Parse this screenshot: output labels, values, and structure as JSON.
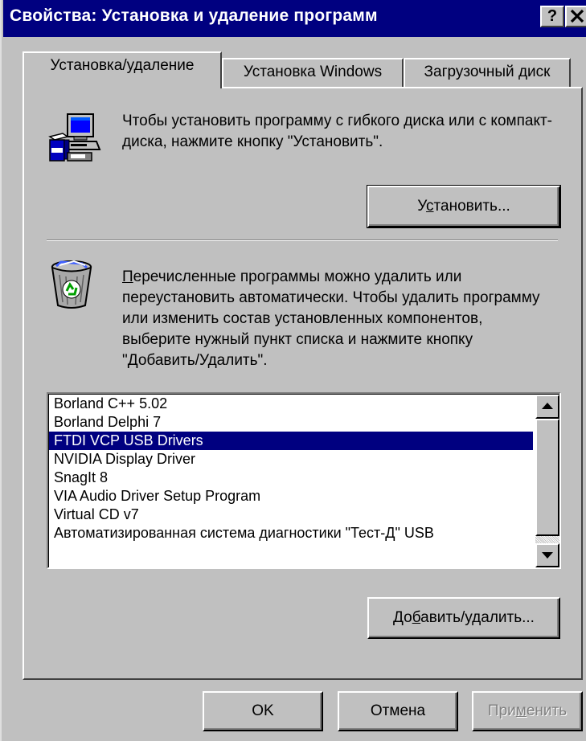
{
  "window": {
    "title": "Свойства: Установка и удаление программ",
    "help_label": "?",
    "close_label": "✕"
  },
  "tabs": [
    {
      "label": "Установка/удаление"
    },
    {
      "label": "Установка Windows"
    },
    {
      "label": "Загрузочный диск"
    }
  ],
  "install_section": {
    "text": "Чтобы установить программу с гибкого диска или с компакт-диска, нажмите кнопку \"Установить\".",
    "button_pre": "У",
    "button_ul": "с",
    "button_post": "тановить..."
  },
  "remove_section": {
    "text_ul": "П",
    "text_rest": "еречисленные программы можно удалить или переустановить автоматически. Чтобы удалить программу или изменить состав установленных компонентов, выберите нужный пункт списка и нажмите кнопку \"Добавить/Удалить\".",
    "button_pre": "До",
    "button_ul": "б",
    "button_post": "авить/удалить..."
  },
  "programs": {
    "items": [
      "Borland C++ 5.02",
      "Borland Delphi 7",
      "FTDI VCP USB Drivers",
      "NVIDIA Display Driver",
      "SnagIt 8",
      "VIA Audio Driver Setup Program",
      "Virtual CD v7",
      "Автоматизированная система диагностики \"Тест-Д\" USB"
    ],
    "selected_index": 2
  },
  "footer": {
    "ok_label": "OK",
    "cancel_label": "Отмена",
    "apply_pre": "При",
    "apply_ul": "м",
    "apply_post": "енить"
  },
  "icons": {
    "computer": "computer-install-icon",
    "recycle": "recycle-bin-icon"
  },
  "colors": {
    "titlebar": "#000080",
    "face": "#c0c0c0",
    "selection": "#000080"
  }
}
